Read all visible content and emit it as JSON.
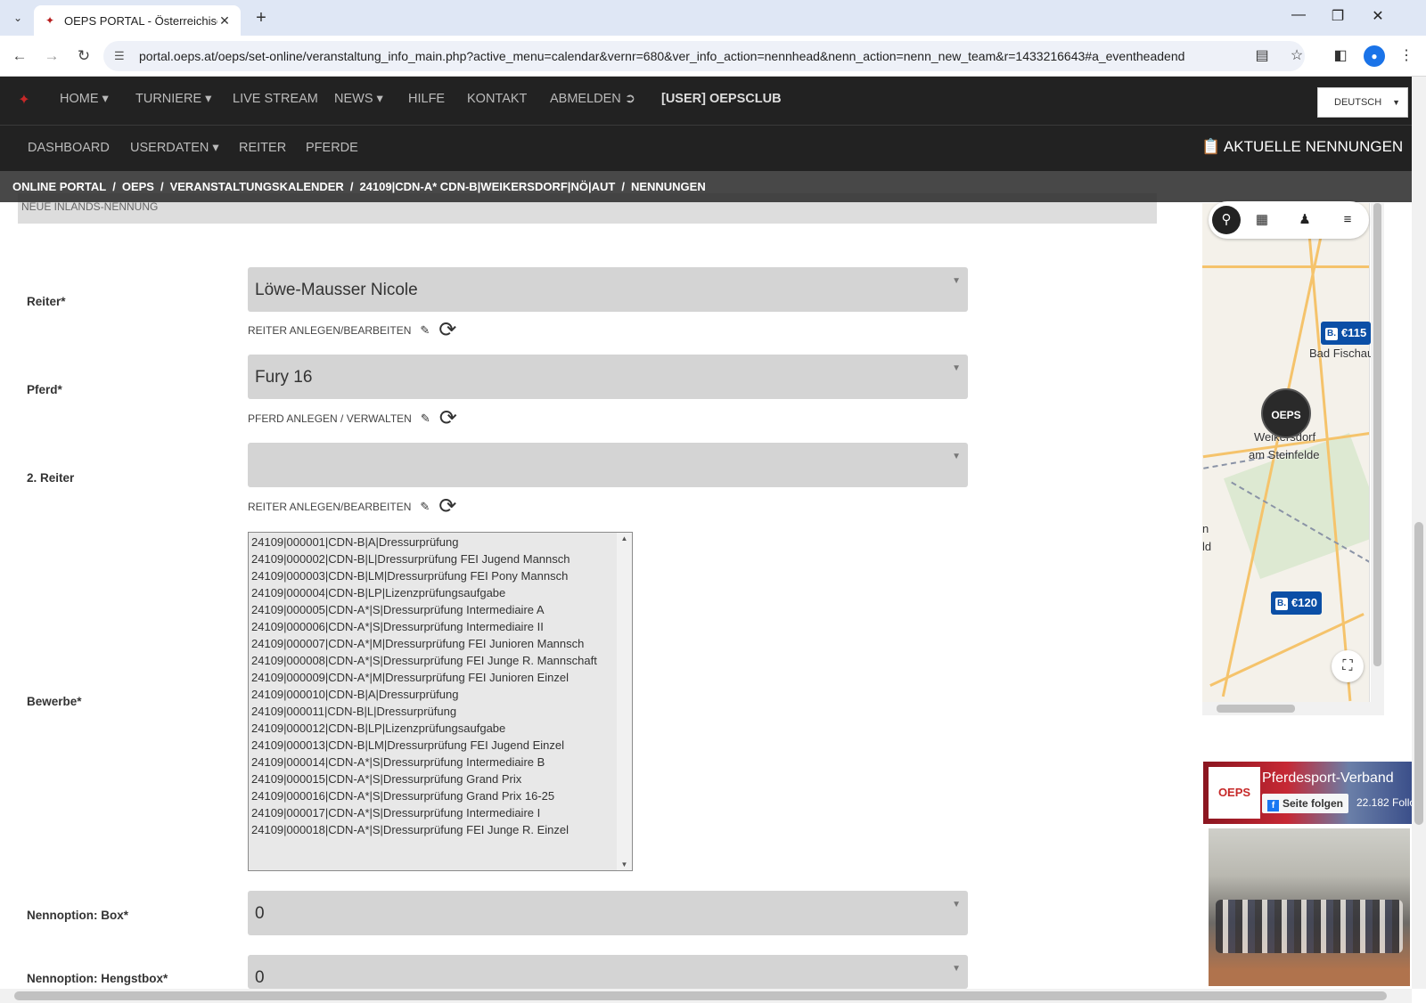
{
  "browser": {
    "tab_title": "OEPS PORTAL - Österreichische",
    "url": "portal.oeps.at/oeps/set-online/veranstaltung_info_main.php?active_menu=calendar&vernr=680&ver_info_action=nennhead&nenn_action=nenn_new_team&r=1433216643#a_eventheadend"
  },
  "topnav": {
    "items": [
      "HOME",
      "TURNIERE",
      "LIVE STREAM",
      "NEWS",
      "HILFE",
      "KONTAKT",
      "ABMELDEN"
    ],
    "user": "[USER] OEPSCLUB",
    "language": "DEUTSCH"
  },
  "subnav": {
    "items": [
      "DASHBOARD",
      "USERDATEN",
      "REITER",
      "PFERDE"
    ],
    "current": "AKTUELLE NENNUNGEN"
  },
  "breadcrumb": [
    "ONLINE PORTAL",
    "OEPS",
    "VERANSTALTUNGSKALENDER",
    "24109|CDN-A* CDN-B|WEIKERSDORF|NÖ|AUT",
    "NENNUNGEN"
  ],
  "section_title": "NEUE INLANDS-NENNUNG",
  "form": {
    "reiter_label": "Reiter*",
    "reiter_value": "Löwe-Mausser Nicole",
    "reiter_link": "REITER ANLEGEN/BEARBEITEN",
    "pferd_label": "Pferd*",
    "pferd_value": "Fury 16",
    "pferd_link": "PFERD ANLEGEN / VERWALTEN",
    "reiter2_label": "2. Reiter",
    "reiter2_value": "",
    "reiter2_link": "REITER ANLEGEN/BEARBEITEN",
    "bewerbe_label": "Bewerbe*",
    "bewerbe": [
      "24109|000001|CDN-B|A|Dressurprüfung",
      "24109|000002|CDN-B|L|Dressurprüfung FEI Jugend Mannsch",
      "24109|000003|CDN-B|LM|Dressurprüfung FEI Pony Mannsch",
      "24109|000004|CDN-B|LP|Lizenzprüfungsaufgabe",
      "24109|000005|CDN-A*|S|Dressurprüfung Intermediaire A",
      "24109|000006|CDN-A*|S|Dressurprüfung Intermediaire II",
      "24109|000007|CDN-A*|M|Dressurprüfung FEI Junioren Mannsch",
      "24109|000008|CDN-A*|S|Dressurprüfung FEI Junge R. Mannschaft",
      "24109|000009|CDN-A*|M|Dressurprüfung FEI Junioren Einzel",
      "24109|000010|CDN-B|A|Dressurprüfung",
      "24109|000011|CDN-B|L|Dressurprüfung",
      "24109|000012|CDN-B|LP|Lizenzprüfungsaufgabe",
      "24109|000013|CDN-B|LM|Dressurprüfung FEI Jugend Einzel",
      "24109|000014|CDN-A*|S|Dressurprüfung Intermediaire B",
      "24109|000015|CDN-A*|S|Dressurprüfung Grand Prix",
      "24109|000016|CDN-A*|S|Dressurprüfung Grand Prix 16-25",
      "24109|000017|CDN-A*|S|Dressurprüfung Intermediaire I",
      "24109|000018|CDN-A*|S|Dressurprüfung FEI Junge R. Einzel"
    ],
    "box_label": "Nennoption: Box*",
    "box_value": "0",
    "hengstbox_label": "Nennoption: Hengstbox*",
    "hengstbox_value": "0"
  },
  "map": {
    "pins": [
      "€115",
      "€120"
    ],
    "towns": [
      "Bad Fischau",
      "Weikersdorf",
      "am Steinfelde",
      "n",
      "ld"
    ],
    "marker_label": "OEPS"
  },
  "facebook": {
    "page_name": "Pferdesport-Verband",
    "follow": "Seite folgen",
    "followers": "22.182 Follo",
    "logo": "OEPS"
  }
}
